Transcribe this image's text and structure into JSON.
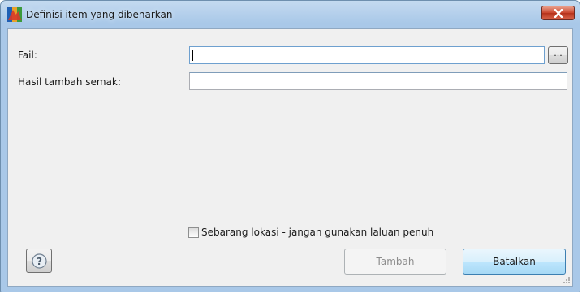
{
  "window": {
    "title": "Definisi item yang dibenarkan",
    "icon": "avg-logo-icon",
    "close_icon": "close-icon"
  },
  "form": {
    "file_label": "Fail:",
    "file_value": "",
    "browse_label": "...",
    "result_label": "Hasil tambah semak:",
    "result_value": ""
  },
  "options": {
    "any_location_label": "Sebarang lokasi - jangan gunakan laluan penuh",
    "any_location_checked": false
  },
  "buttons": {
    "help_icon": "help-icon",
    "add_label": "Tambah",
    "add_enabled": false,
    "cancel_label": "Batalkan"
  },
  "colors": {
    "titlebar": "#b9d3ee",
    "close_button": "#c9432b",
    "client_background": "#f0f0f0",
    "default_button": "#bee6fd",
    "disabled_text": "#8d8d8d"
  }
}
